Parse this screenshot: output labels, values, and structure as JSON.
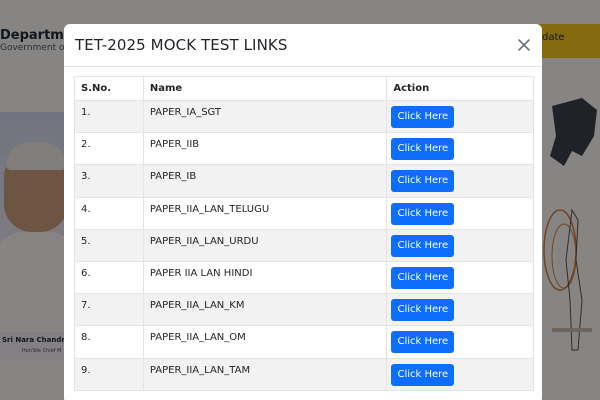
{
  "background": {
    "dept_title": "Department",
    "dept_subtitle": "Government of A",
    "update_label": "date",
    "cm_name": "Sri Nara Chandrab",
    "cm_role": "Hon'ble Chief M"
  },
  "modal": {
    "title": "TET-2025 MOCK TEST LINKS",
    "close_icon": "close-icon",
    "columns": [
      "S.No.",
      "Name",
      "Action"
    ],
    "rows": [
      {
        "sno": "1.",
        "name": "PAPER_IA_SGT",
        "action": "Click Here"
      },
      {
        "sno": "2.",
        "name": "PAPER_IIB",
        "action": "Click Here"
      },
      {
        "sno": "3.",
        "name": "PAPER_IB",
        "action": "Click Here"
      },
      {
        "sno": "4.",
        "name": "PAPER_IIA_LAN_TELUGU",
        "action": "Click Here"
      },
      {
        "sno": "5.",
        "name": "PAPER_IIA_LAN_URDU",
        "action": "Click Here"
      },
      {
        "sno": "6.",
        "name": "PAPER IIA LAN HINDI",
        "action": "Click Here"
      },
      {
        "sno": "7.",
        "name": "PAPER_IIA_LAN_KM",
        "action": "Click Here"
      },
      {
        "sno": "8.",
        "name": "PAPER_IIA_LAN_OM",
        "action": "Click Here"
      },
      {
        "sno": "9.",
        "name": "PAPER_IIA_LAN_TAM",
        "action": "Click Here"
      }
    ]
  },
  "colors": {
    "primary_button": "#0d6efd",
    "accent_yellow": "#f2c21a",
    "overlay": "rgba(0,0,0,0.45)"
  }
}
